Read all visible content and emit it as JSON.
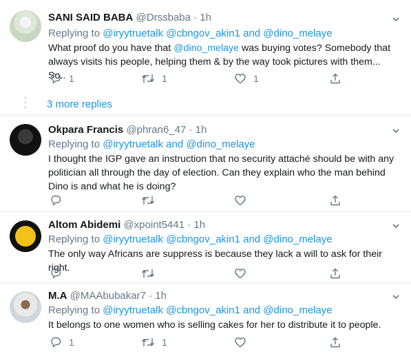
{
  "tweets": [
    {
      "name": "SANI SAID BABA",
      "handle": "@Drssbaba",
      "dot": "·",
      "time": "1h",
      "replying_prefix": "Replying to ",
      "replying_links": "@iryytruetalk @cbngov_akin1 and @dino_melaye",
      "line1_a": "What proof do you have that ",
      "line1_mention": "@dino_melaye",
      "line1_b": "  was buying votes? Somebody that",
      "line2": "always visits his people, helping them & by the way took pictures with them... So..",
      "replies": "1",
      "retweets": "1",
      "likes": "1"
    },
    {
      "name": "Okpara Francis",
      "handle": "@phran6_47",
      "dot": "·",
      "time": "1h",
      "replying_prefix": "Replying to ",
      "replying_links": "@iryytruetalk and @dino_melaye",
      "lines": [
        "I thought the IGP gave an instruction that no security attaché should be with any",
        "politician all through the day of election. Can they explain who the man behind",
        "Dino is and what he is doing?"
      ]
    },
    {
      "name": "Altom Abidemi",
      "handle": "@xpoint5441",
      "dot": "·",
      "time": "1h",
      "replying_prefix": "Replying to ",
      "replying_links": "@iryytruetalk @cbngov_akin1 and @dino_melaye",
      "lines": [
        "The only way Africans are suppress is because they lack a will to ask for their right."
      ]
    },
    {
      "name": "M.A",
      "handle": "@MAAbubakar7",
      "dot": "·",
      "time": "1h",
      "replying_prefix": "Replying to ",
      "replying_links": "@iryytruetalk @cbngov_akin1 and @dino_melaye",
      "lines": [
        "It belongs to one women who is selling cakes for her to distribute it to people."
      ],
      "replies": "1",
      "retweets": "1"
    }
  ],
  "more_replies": "3 more replies",
  "colors": {
    "link": "#1b95e0",
    "muted": "#657786",
    "text": "#14171a",
    "divider": "#e6ecf0"
  },
  "icons": [
    "reply-icon",
    "retweet-icon",
    "like-icon",
    "share-icon",
    "chevron-down-icon"
  ]
}
